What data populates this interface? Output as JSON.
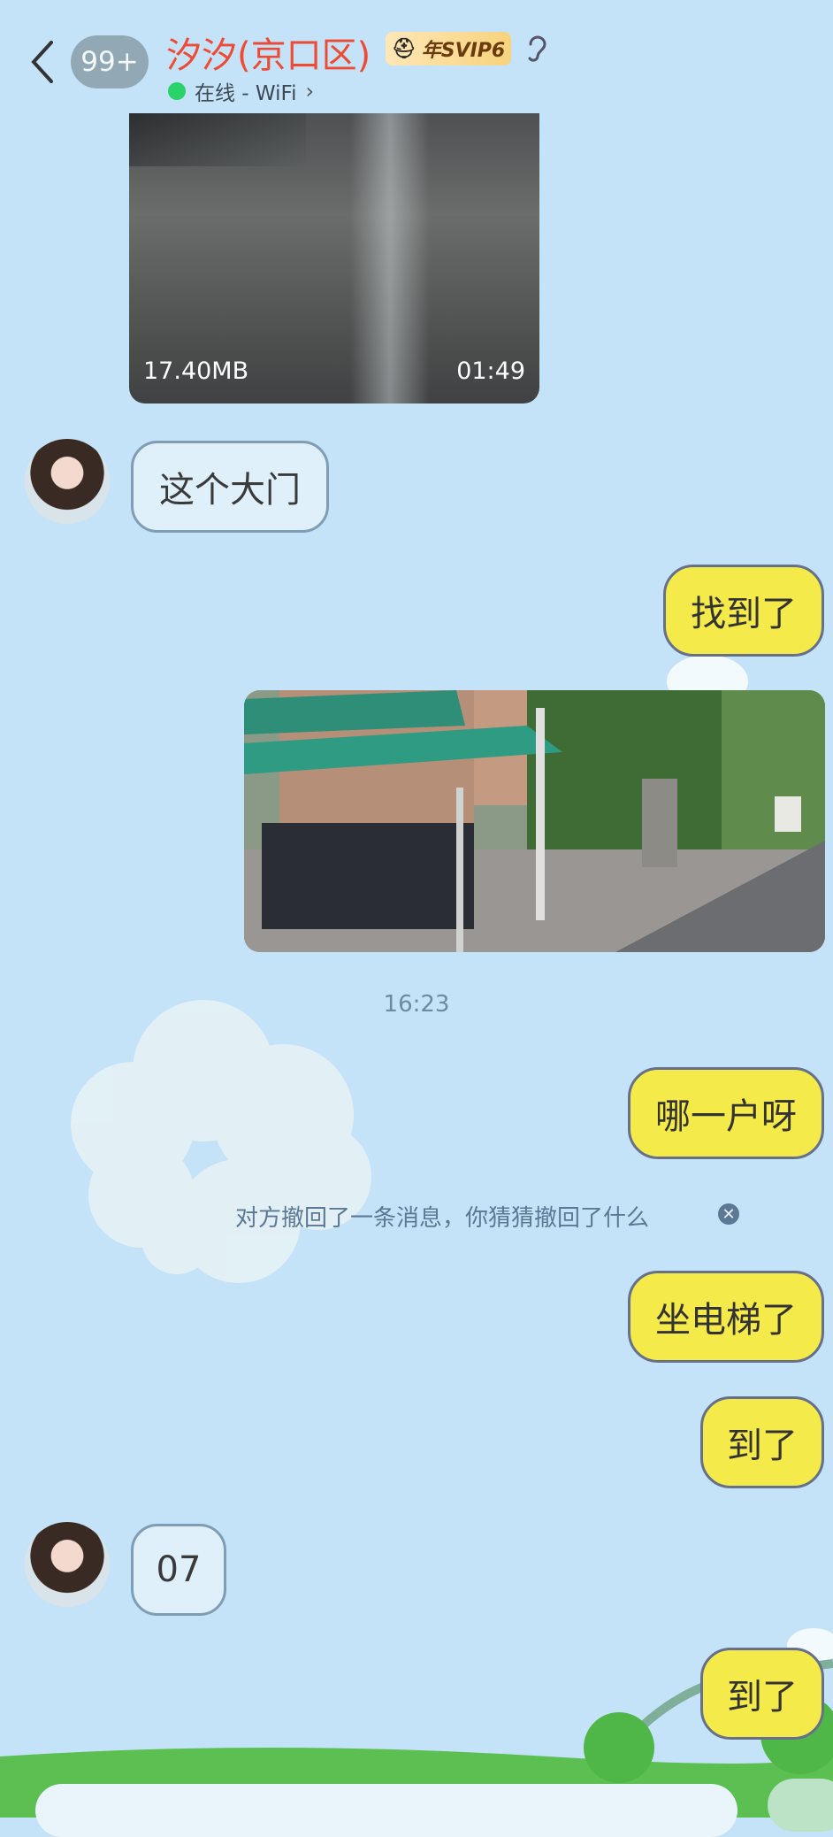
{
  "header": {
    "badge_count": "99+",
    "contact_name": "汐汐(京口区)",
    "vip_label": "年SVIP6",
    "status_text": "在线 - WiFi",
    "status_color": "#2ad26a",
    "name_color": "#ee4a34"
  },
  "video": {
    "size": "17.40MB",
    "duration": "01:49"
  },
  "messages": [
    {
      "side": "in",
      "text": "这个大门"
    },
    {
      "side": "out",
      "text": "找到了"
    },
    {
      "side": "out",
      "type": "image"
    },
    {
      "side": "out",
      "text": "哪一户呀"
    },
    {
      "side": "out",
      "text": "坐电梯了"
    },
    {
      "side": "out",
      "text": "到了"
    },
    {
      "side": "in",
      "text": "07"
    },
    {
      "side": "out",
      "text": "到了"
    }
  ],
  "timestamp": "16:23",
  "recall_notice": "对方撤回了一条消息，你猜猜撤回了什么",
  "icons": [
    "back-arrow-icon",
    "vip-crown-icon",
    "hearing-icon",
    "close-circle-icon"
  ],
  "colors": {
    "bubble_out": "#f4ea49",
    "bubble_in": "#dff0fb",
    "background": "#c4e3f8"
  }
}
